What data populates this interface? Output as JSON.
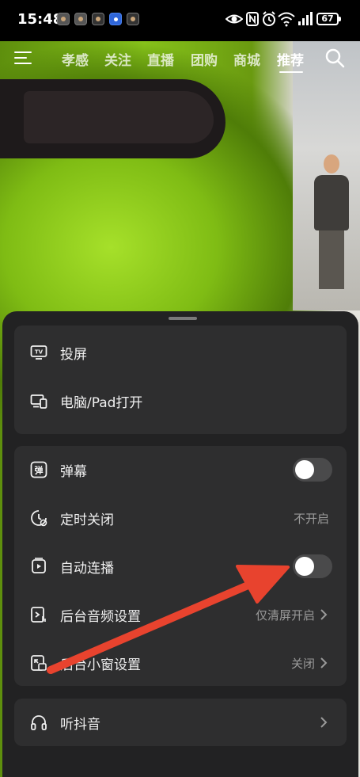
{
  "status_bar": {
    "time": "15:48",
    "battery": "67",
    "notification_icons": [
      "app-notification-icon",
      "app-notification-icon",
      "app-notification-icon",
      "app-notification-icon",
      "app-notification-icon"
    ],
    "system_icons": [
      "eye-icon",
      "nfc-icon",
      "alarm-icon",
      "wifi-icon",
      "signal-icon",
      "battery-icon"
    ]
  },
  "top_nav": {
    "tabs": [
      {
        "label": "孝感",
        "active": false
      },
      {
        "label": "关注",
        "active": false
      },
      {
        "label": "直播",
        "active": false
      },
      {
        "label": "团购",
        "active": false
      },
      {
        "label": "商城",
        "active": false
      },
      {
        "label": "推荐",
        "active": true
      }
    ]
  },
  "sheet": {
    "group1": [
      {
        "label": "投屏",
        "icon": "tv-icon"
      },
      {
        "label": "电脑/Pad打开",
        "icon": "devices-icon"
      }
    ],
    "group2": [
      {
        "label": "弹幕",
        "icon": "danmaku-icon",
        "control": "toggle",
        "on": false
      },
      {
        "label": "定时关闭",
        "icon": "timer-icon",
        "value": "不开启"
      },
      {
        "label": "自动连播",
        "icon": "autoplay-icon",
        "control": "toggle",
        "on": false
      },
      {
        "label": "后台音频设置",
        "icon": "background-audio-icon",
        "value": "仅清屏开启"
      },
      {
        "label": "后台小窗设置",
        "icon": "mini-window-icon",
        "value": "关闭"
      }
    ],
    "group3": [
      {
        "label": "听抖音",
        "icon": "headphones-icon"
      }
    ]
  },
  "colors": {
    "sheet_bg": "#222223",
    "group_bg": "#2e2e2f",
    "arrow": "#e8432e"
  }
}
